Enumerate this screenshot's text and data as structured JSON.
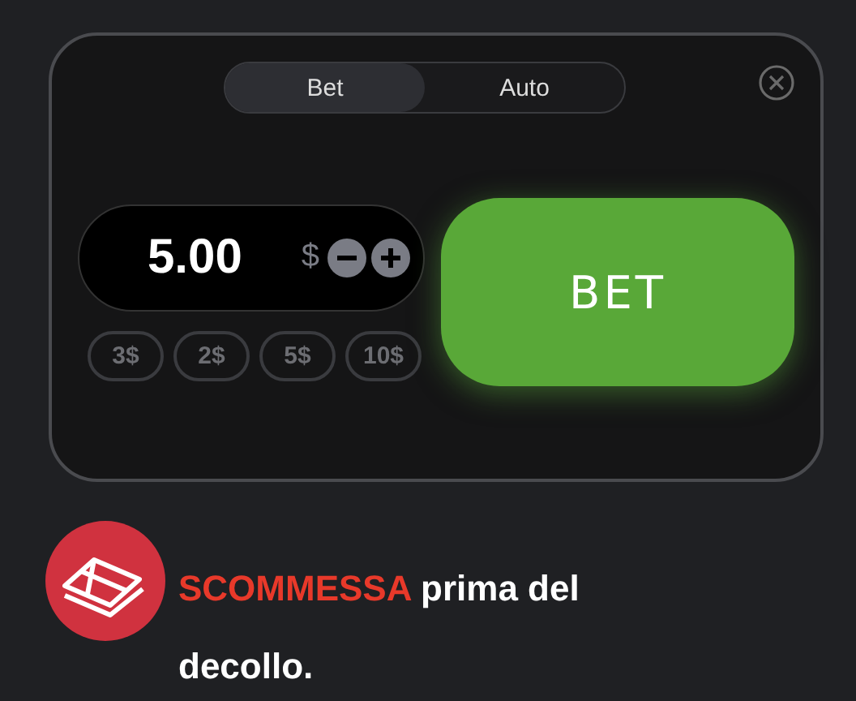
{
  "panel": {
    "tabs": [
      {
        "label": "Bet",
        "selected": true
      },
      {
        "label": "Auto",
        "selected": false
      }
    ],
    "amount": {
      "value": "5.00",
      "currency": "$"
    },
    "quick_amounts": [
      "3$",
      "2$",
      "5$",
      "10$"
    ],
    "bet_button": "BET"
  },
  "caption": {
    "highlight": "SCOMMESSA",
    "text": "prima del decollo."
  }
}
